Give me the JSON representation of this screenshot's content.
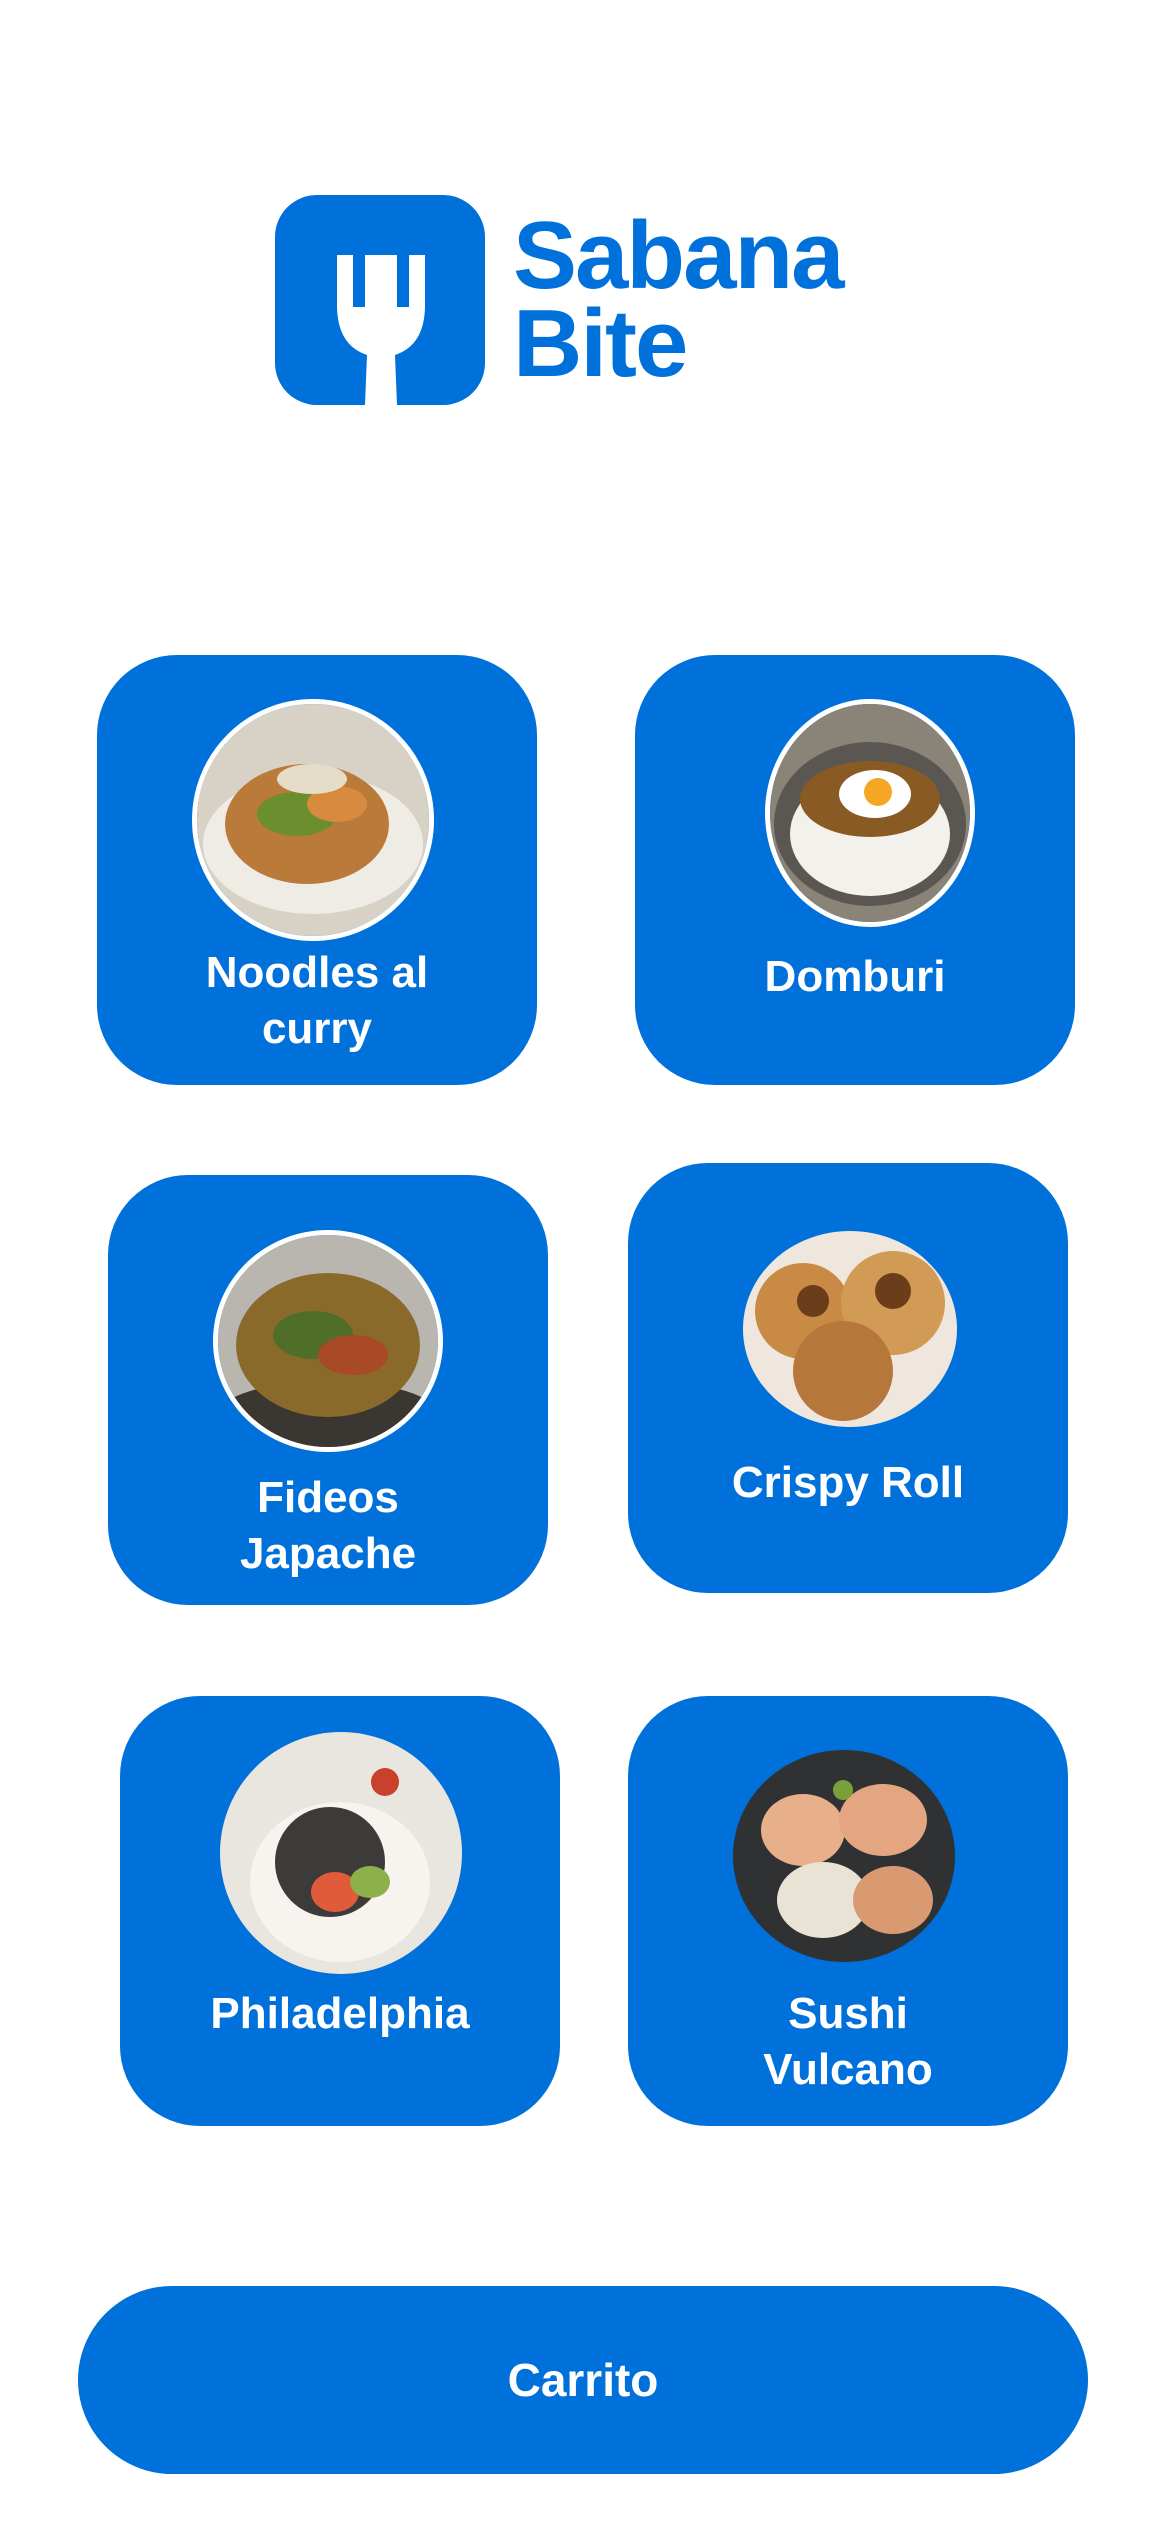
{
  "brand": {
    "name_line1": "Sabana",
    "name_line2": "Bite",
    "color": "#0071DA",
    "logo_icon": "fork-icon"
  },
  "menu": {
    "items": [
      {
        "label": "Noodles al curry",
        "image": "noodles-curry-photo"
      },
      {
        "label": "Domburi",
        "image": "domburi-photo"
      },
      {
        "label": "Fideos Japache",
        "image": "fideos-japache-photo"
      },
      {
        "label": "Crispy Roll",
        "image": "crispy-roll-photo"
      },
      {
        "label": "Philadelphia",
        "image": "philadelphia-roll-photo"
      },
      {
        "label": "Sushi Vulcano",
        "image": "sushi-vulcano-photo"
      }
    ]
  },
  "cart": {
    "label": "Carrito"
  }
}
